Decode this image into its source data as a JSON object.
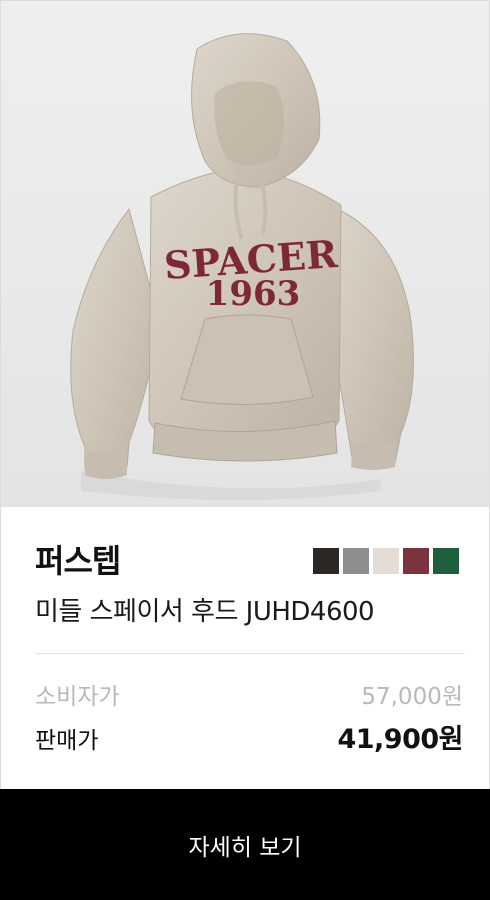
{
  "product": {
    "image_alt": "oatmeal hoodie with SPACER 1963 print",
    "print_line1": "SPACER",
    "print_line2": "1963",
    "brand": "퍼스텝",
    "name": "미들 스페이서 후드 JUHD4600",
    "color_options": [
      "#2b2826",
      "#8d8d8f",
      "#e6dcd6",
      "#7c3340",
      "#1f5f3e"
    ],
    "original_price_label": "소비자가",
    "original_price": "57,000원",
    "sale_price_label": "판매가",
    "sale_price": "41,900원"
  },
  "cta": {
    "label": "자세히 보기"
  }
}
